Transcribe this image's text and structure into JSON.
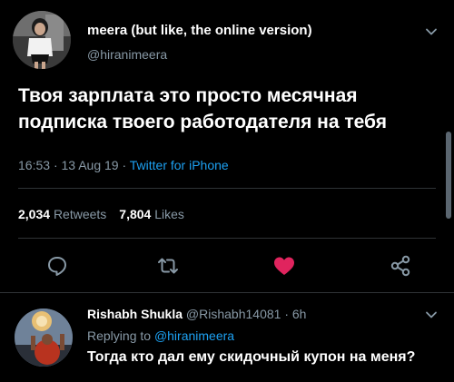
{
  "tweet": {
    "author_name": "meera (but like, the online version)",
    "author_handle": "@hiranimeera",
    "text": "Твоя зарплата это просто месячная подписка твоего работодателя на тебя",
    "time": "16:53",
    "date": "13 Aug 19",
    "source": "Twitter for iPhone",
    "separator": "·",
    "retweet_count": "2,034",
    "retweet_label": "Retweets",
    "like_count": "7,804",
    "like_label": "Likes"
  },
  "actions": {
    "reply_icon": "comment-icon",
    "retweet_icon": "retweet-icon",
    "like_icon": "heart-icon",
    "share_icon": "share-icon",
    "like_color": "#e0245e"
  },
  "reply": {
    "author_name": "Rishabh Shukla",
    "author_handle": "@Rishabh14081",
    "separator": "·",
    "age": "6h",
    "replying_label": "Replying to",
    "replying_to": "@hiranimeera",
    "text": "Тогда кто дал ему скидочный купон на меня?"
  },
  "colors": {
    "background": "#000000",
    "text_primary": "#ffffff",
    "text_secondary": "#8899a6",
    "accent": "#1da1f2",
    "divider": "#2f3336"
  }
}
